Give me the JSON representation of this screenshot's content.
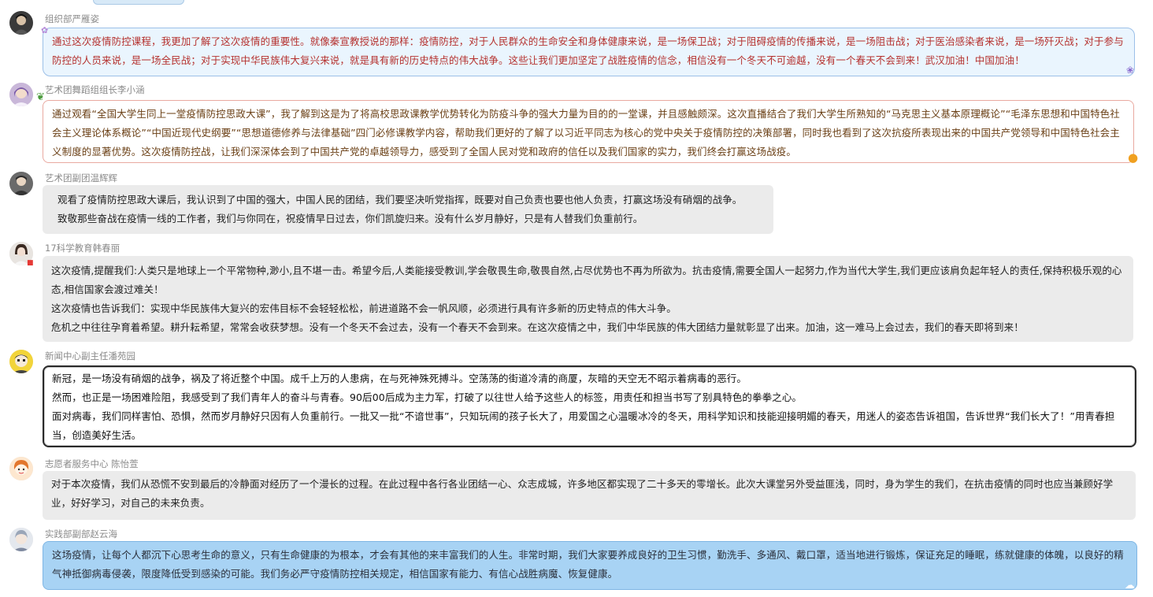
{
  "messages": [
    {
      "name": "组织部严雁姿",
      "paragraphs": [
        "通过这次疫情防控课程，我更加了解了这次疫情的重要性。就像秦宣教授说的那样：疫情防控，对于人民群众的生命安全和身体健康来说，是一场保卫战；对于阻碍疫情的传播来说，是一场阻击战；对于医治感染者来说，是一场歼灭战；对于参与防控的人员来说，是一场全民战；对于实现中华民族伟大复兴来说，就是具有新的历史特点的伟大战争。这些让我们更加坚定了战胜疫情的信念，相信没有一个冬天不可逾越，没有一个春天不会到来！武汉加油！中国加油！"
      ]
    },
    {
      "name": "艺术团舞蹈组组长李小涵",
      "paragraphs": [
        "通过观看“全国大学生同上一堂疫情防控思政大课”，我了解到这是为了将高校思政课教学优势转化为防疫斗争的强大力量为目的的一堂课，并且感触颇深。这次直播结合了我们大学生所熟知的“马克思主义基本原理概论”“毛泽东思想和中国特色社会主义理论体系概论”“中国近现代史纲要”“思想道德修养与法律基础”四门必修课教学内容，帮助我们更好的了解了以习近平同志为核心的党中央关于疫情防控的决策部署，同时我也看到了这次抗疫所表现出来的中国共产党领导和中国特色社会主义制度的显著优势。这次疫情防控战，让我们深深体会到了中国共产党的卓越领导力，感受到了全国人民对党和政府的信任以及我们国家的实力，我们终会打赢这场战疫。"
      ]
    },
    {
      "name": "艺术团副团温辉辉",
      "paragraphs": [
        "观看了疫情防控思政大课后，我认识到了中国的强大，中国人民的团结，我们要坚决听党指挥，既要对自己负责也要也他人负责，打赢这场没有硝烟的战争。",
        "致敬那些奋战在疫情一线的工作者，我们与你同在，祝疫情早日过去，你们凯旋归来。没有什么岁月静好，只是有人替我们负重前行。"
      ]
    },
    {
      "name": "17科学教育韩春丽",
      "paragraphs": [
        "这次疫情,提醒我们:人类只是地球上一个平常物种,渺小,且不堪一击。希望今后,人类能接受教训,学会敬畏生命,敬畏自然,占尽优势也不再为所欲为。抗击疫情,需要全国人一起努力,作为当代大学生,我们更应该肩负起年轻人的责任,保持积极乐观的心态,相信国家会渡过难关！",
        "这次疫情也告诉我们：实现中华民族伟大复兴的宏伟目标不会轻轻松松，前进道路不会一帆风顺，必须进行具有许多新的历史特点的伟大斗争。",
        "危机之中往往孕育着希望。耕升耘希望，常常会收获梦想。没有一个冬天不会过去，没有一个春天不会到来。在这次疫情之中，我们中华民族的伟大团结力量就彰显了出来。加油，这一难马上会过去，我们的春天即将到来！"
      ]
    },
    {
      "name": "新闻中心副主任潘苑园",
      "paragraphs": [
        "新冠，是一场没有硝烟的战争，祸及了将近整个中国。成千上万的人患病，在与死神殊死搏斗。空荡荡的街道冷清的商厦，灰暗的天空无不昭示着病毒的恶行。",
        "然而，也正是一场困难险阻，我感受到了我们青年人的奋斗与青春。90后00后成为主力军，打破了以往世人给予这些人的标签，用责任和担当书写了别具特色的拳拳之心。",
        "面对病毒，我们同样害怕、恐惧，然而岁月静好只因有人负重前行。一批又一批“不谙世事”，只知玩闹的孩子长大了，用爱国之心温暖冰冷的冬天，用科学知识和技能迎接明媚的春天，用迷人的姿态告诉祖国，告诉世界“我们长大了！”用青春担当，创造美好生活。"
      ]
    },
    {
      "name": "志愿者服务中心 陈怡萱",
      "paragraphs": [
        "对于本次疫情，我们从恐慌不安到最后的冷静面对经历了一个漫长的过程。在此过程中各行各业团结一心、众志成城，许多地区都实现了二十多天的零增长。此次大课堂另外受益匪浅，同时，身为学生的我们，在抗击疫情的同时也应当兼顾好学业，好好学习，对自己的未来负责。"
      ]
    },
    {
      "name": "实践部副部赵云海",
      "paragraphs": [
        "这场疫情，让每个人都沉下心思考生命的意义，只有生命健康的为根本，才会有其他的来丰富我们的人生。非常时期，我们大家要养成良好的卫生习惯，勤洗手、多通风、戴口罩，适当地进行锻炼，保证充足的睡眠，练就健康的体魄，以良好的精气神抵御病毒侵袭，限度降低受到感染的可能。我们务必严守疫情防控相关规定，相信国家有能力、有信心战胜病魔、恢复健康。"
      ]
    }
  ]
}
